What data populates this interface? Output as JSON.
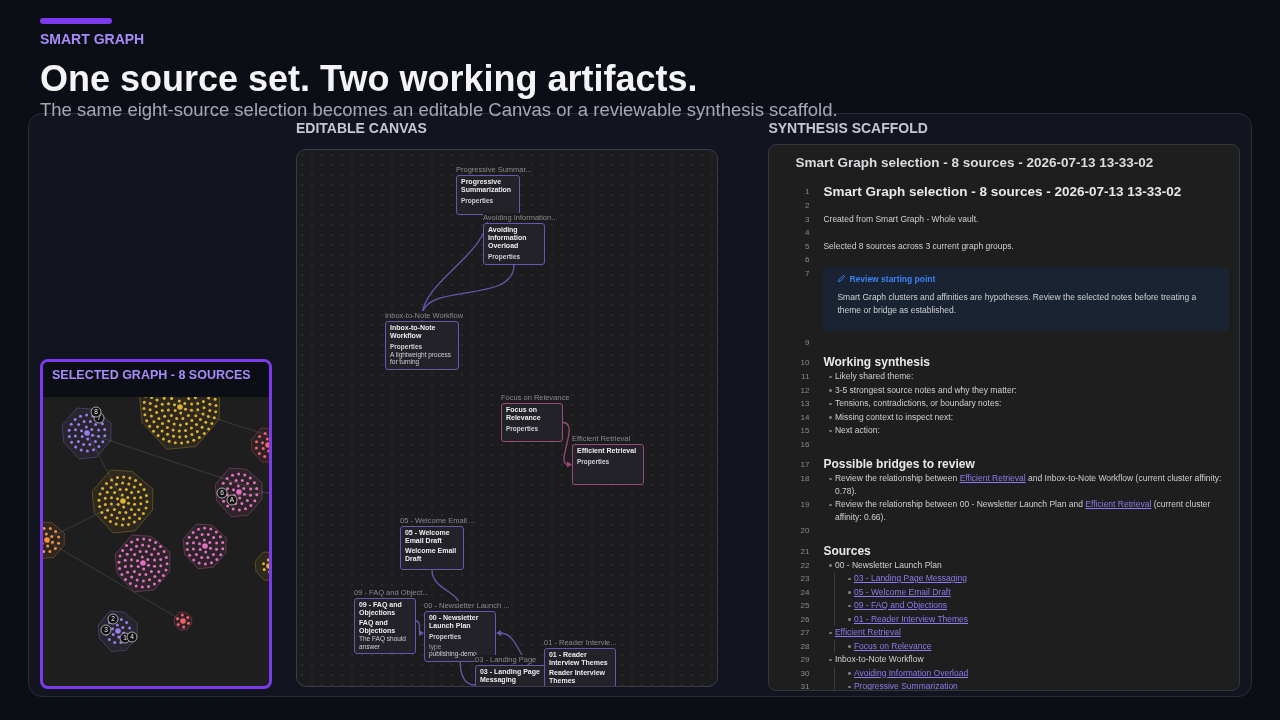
{
  "header": {
    "eyebrow": "SMART GRAPH",
    "title": "One source set. Two working artifacts.",
    "subtitle": "The same eight-source selection becomes an editable Canvas or a reviewable synthesis scaffold."
  },
  "graph": {
    "title": "SELECTED GRAPH - 8 SOURCES",
    "clusters": [
      {
        "color": "#9b7bf0",
        "badges": [
          "7",
          "8"
        ]
      },
      {
        "color": "#e0b030"
      },
      {
        "color": "#e0b030"
      },
      {
        "color": "#e070c0",
        "badges": [
          "6",
          "A"
        ]
      },
      {
        "color": "#f09040"
      },
      {
        "color": "#e070c0"
      },
      {
        "color": "#e070c0"
      },
      {
        "color": "#f06070"
      },
      {
        "color": "#9b7bf0",
        "badges": [
          "2",
          "3",
          "1",
          "4"
        ]
      },
      {
        "color": "#f06070"
      },
      {
        "color": "#e0b030"
      }
    ]
  },
  "canvas": {
    "label": "EDITABLE CANVAS",
    "nodes": [
      {
        "label": "Progressive Summar...",
        "title": "Progressive Summarization",
        "color": "#6a56b0",
        "items": [
          {
            "kind": "heading",
            "text": "Properties"
          }
        ]
      },
      {
        "label": "Avoiding Information...",
        "title": "Avoiding Information Overload",
        "color": "#6a56b0",
        "items": [
          {
            "kind": "heading",
            "text": "Properties"
          }
        ]
      },
      {
        "label": "Inbox-to-Note Workflow",
        "title": "Inbox-to-Note Workflow",
        "color": "#6a56b0",
        "items": [
          {
            "kind": "heading",
            "text": "Properties"
          },
          {
            "kind": "value",
            "text": "A lightweight process for turning"
          }
        ]
      },
      {
        "label": "Focus on Relevance",
        "title": "Focus on Relevance",
        "color": "#9a4a78",
        "items": [
          {
            "kind": "heading",
            "text": "Properties"
          }
        ]
      },
      {
        "label": "Efficient Retrieval",
        "title": "Efficient Retrieval",
        "color": "#9a4a78",
        "items": [
          {
            "kind": "heading",
            "text": "Properties"
          }
        ]
      },
      {
        "label": "05 - Welcome Email ...",
        "title": "05 - Welcome Email Draft",
        "subtitle": "Welcome Email Draft",
        "color": "#6a56b0"
      },
      {
        "label": "09 - FAQ and Object...",
        "title": "09 - FAQ and Objections",
        "subtitle": "FAQ and Objections",
        "color": "#6a56b0",
        "items": [
          {
            "kind": "value",
            "text": "The FAQ should answer"
          }
        ]
      },
      {
        "label": "00 - Newsletter Launch ...",
        "title": "00 - Newsletter Launch Plan",
        "color": "#6a56b0",
        "items": [
          {
            "kind": "heading",
            "text": "Properties"
          },
          {
            "kind": "key",
            "text": "type"
          },
          {
            "kind": "value",
            "text": "publishing-demo"
          }
        ]
      },
      {
        "label": "03 - Landing Page",
        "title": "03 - Landing Page Messaging",
        "color": "#6a56b0"
      },
      {
        "label": "01 - Reader Intervie...",
        "title": "01 - Reader Interview Themes",
        "subtitle": "Reader Interview Themes",
        "color": "#6a56b0"
      }
    ]
  },
  "scaffold": {
    "label": "SYNTHESIS SCAFFOLD",
    "tab_title": "Smart Graph selection - 8 sources - 2026-07-13 13-33-02",
    "lines": [
      {
        "n": "1",
        "kind": "h1",
        "text": "Smart Graph selection - 8 sources - 2026-07-13 13-33-02"
      },
      {
        "n": "2",
        "kind": "blank"
      },
      {
        "n": "3",
        "kind": "text",
        "text": "Created from Smart Graph - Whole vault."
      },
      {
        "n": "4",
        "kind": "blank"
      },
      {
        "n": "5",
        "kind": "text",
        "text": "Selected 8 sources across 3 current graph groups."
      },
      {
        "n": "6",
        "kind": "blank"
      },
      {
        "n": "7",
        "kind": "callout",
        "title": "Review starting point",
        "text": "Smart Graph clusters and affinities are hypotheses. Review the selected notes before treating a theme or bridge as established."
      },
      {
        "n": "9",
        "kind": "blank"
      },
      {
        "n": "10",
        "kind": "h2",
        "text": "Working synthesis"
      },
      {
        "n": "11",
        "kind": "bullet",
        "parts": [
          {
            "text": "Likely shared theme:",
            "link": false
          }
        ]
      },
      {
        "n": "12",
        "kind": "bullet",
        "parts": [
          {
            "text": "3-5 strongest source notes and why they matter:",
            "link": false
          }
        ]
      },
      {
        "n": "13",
        "kind": "bullet",
        "parts": [
          {
            "text": "Tensions, contradictions, or boundary notes:",
            "link": false
          }
        ]
      },
      {
        "n": "14",
        "kind": "bullet",
        "parts": [
          {
            "text": "Missing context to inspect next:",
            "link": false
          }
        ]
      },
      {
        "n": "15",
        "kind": "bullet",
        "parts": [
          {
            "text": "Next action:",
            "link": false
          }
        ]
      },
      {
        "n": "16",
        "kind": "blank"
      },
      {
        "n": "17",
        "kind": "h2",
        "text": "Possible bridges to review"
      },
      {
        "n": "18",
        "kind": "bullet",
        "parts": [
          {
            "text": "Review the relationship between ",
            "link": false
          },
          {
            "text": "Efficient Retrieval",
            "link": true
          },
          {
            "text": " and Inbox-to-Note Workflow (current cluster affinity: 0.78).",
            "link": false
          }
        ]
      },
      {
        "n": "19",
        "kind": "bullet",
        "parts": [
          {
            "text": "Review the relationship between 00 - Newsletter Launch Plan and ",
            "link": false
          },
          {
            "text": "Efficient Retrieval",
            "link": true
          },
          {
            "text": " (current cluster affinity: 0.66).",
            "link": false
          }
        ]
      },
      {
        "n": "20",
        "kind": "blank"
      },
      {
        "n": "21",
        "kind": "h2",
        "text": "Sources"
      },
      {
        "n": "22",
        "kind": "bullet",
        "parts": [
          {
            "text": "00 - Newsletter Launch Plan",
            "link": false
          }
        ],
        "children": [
          {
            "n": "23",
            "kind": "bullet",
            "parts": [
              {
                "text": "03 - Landing Page Messaging",
                "link": true
              }
            ]
          },
          {
            "n": "24",
            "kind": "bullet",
            "parts": [
              {
                "text": "05 - Welcome Email Draft",
                "link": true
              }
            ]
          },
          {
            "n": "25",
            "kind": "bullet",
            "parts": [
              {
                "text": "09 - FAQ and Objections",
                "link": true
              }
            ]
          },
          {
            "n": "26",
            "kind": "bullet",
            "parts": [
              {
                "text": "01 - Reader Interview Themes",
                "link": true
              }
            ]
          }
        ]
      },
      {
        "n": "27",
        "kind": "bullet",
        "parts": [
          {
            "text": "Efficient Retrieval",
            "link": true
          }
        ],
        "children": [
          {
            "n": "28",
            "kind": "bullet",
            "parts": [
              {
                "text": "Focus on Relevance",
                "link": true
              }
            ]
          }
        ]
      },
      {
        "n": "29",
        "kind": "bullet",
        "parts": [
          {
            "text": "Inbox-to-Note Workflow",
            "link": false
          }
        ],
        "children": [
          {
            "n": "30",
            "kind": "bullet",
            "parts": [
              {
                "text": "Avoiding Information Overload",
                "link": true
              }
            ]
          },
          {
            "n": "31",
            "kind": "bullet",
            "parts": [
              {
                "text": "Progressive Summarization",
                "link": true
              }
            ]
          }
        ]
      }
    ]
  }
}
